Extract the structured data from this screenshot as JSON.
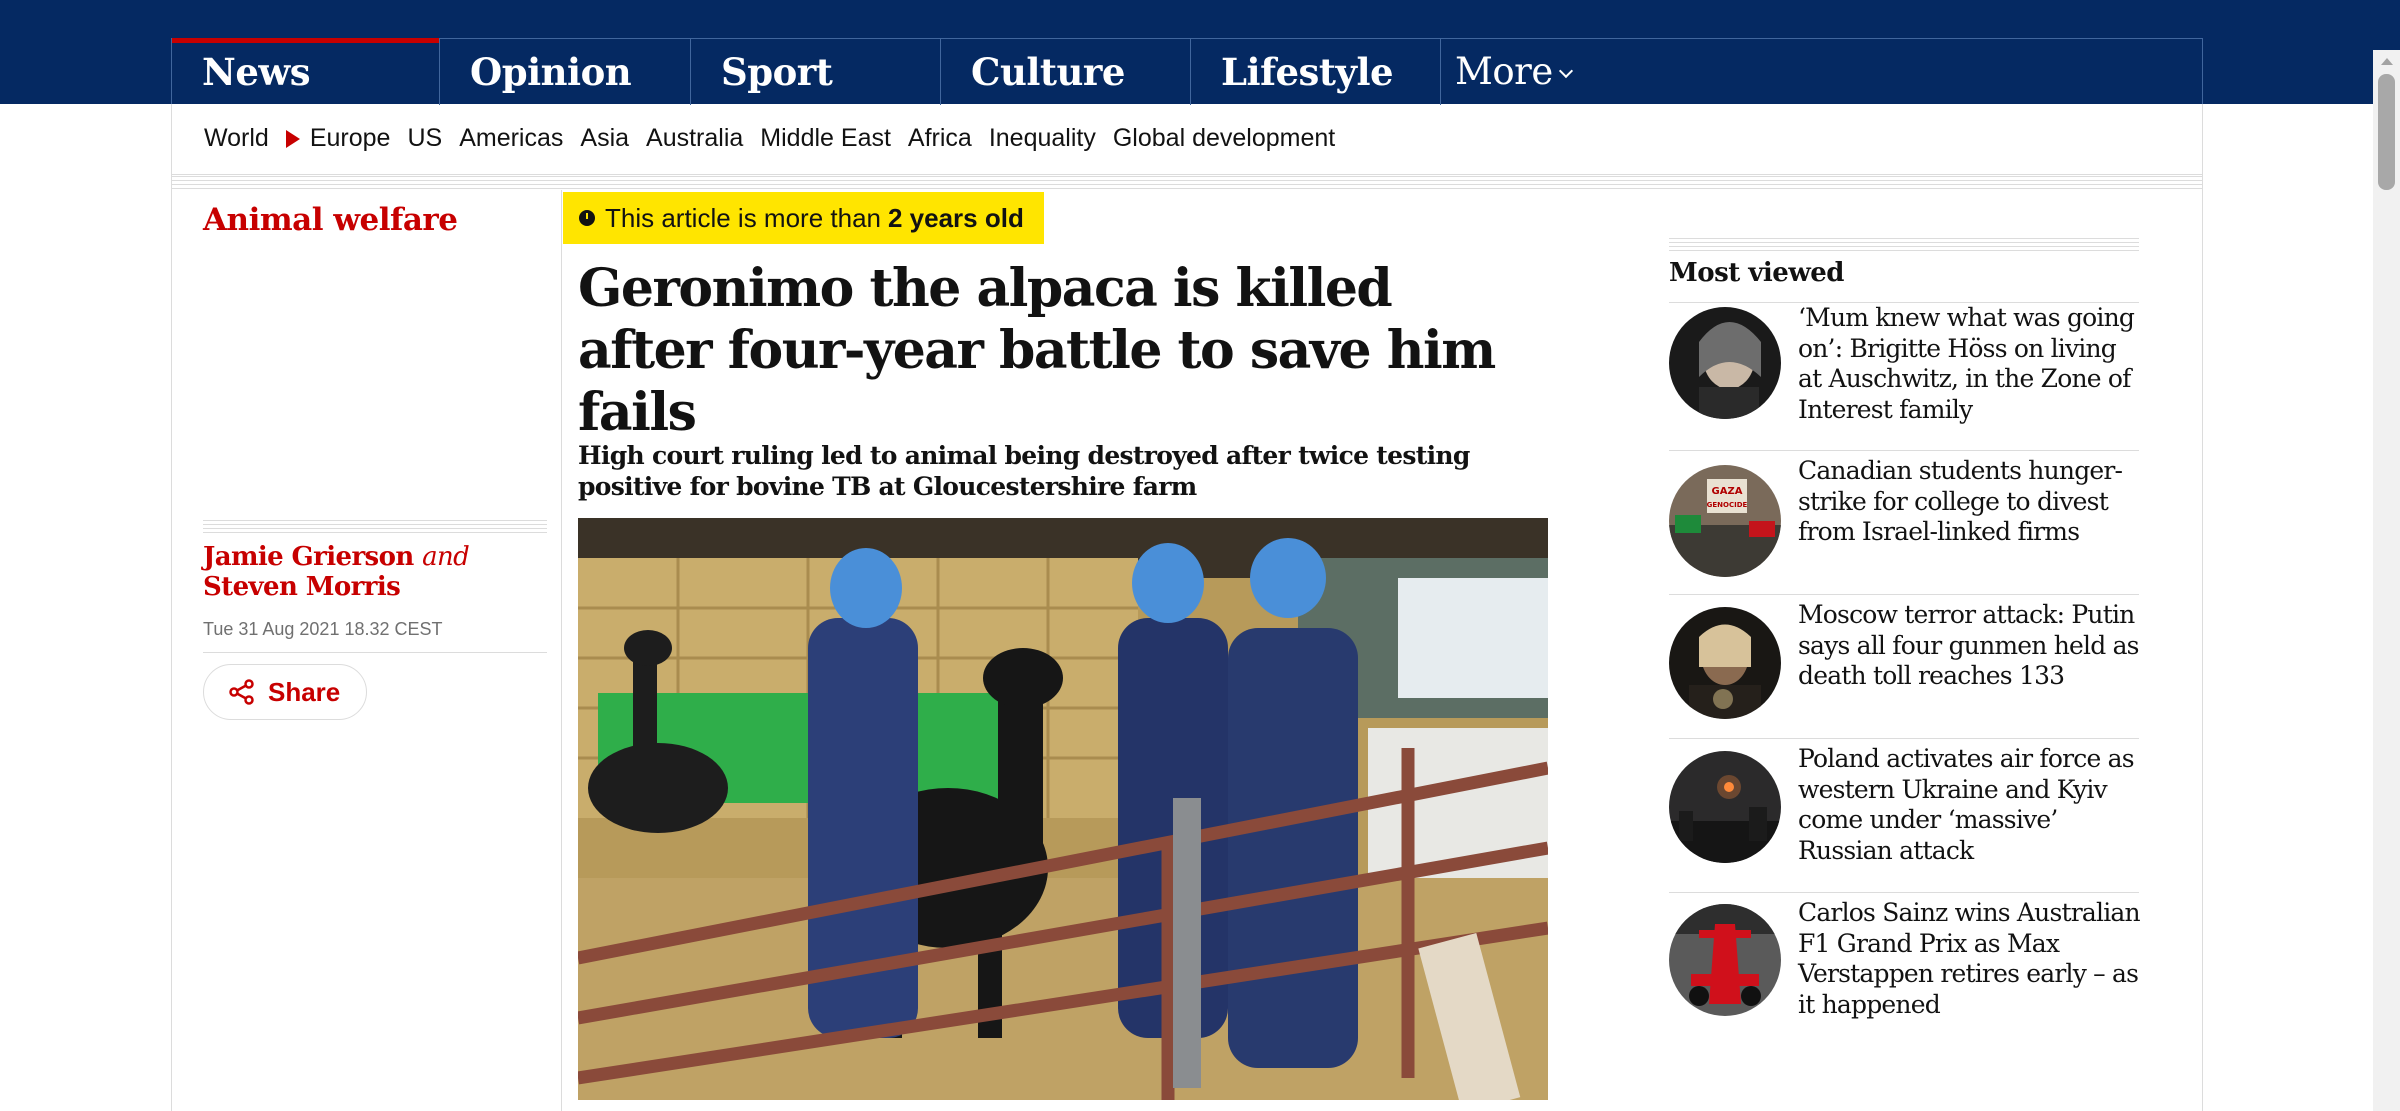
{
  "nav": {
    "pillars": [
      "News",
      "Opinion",
      "Sport",
      "Culture",
      "Lifestyle"
    ],
    "more_label": "More"
  },
  "subnav": {
    "items": [
      "World",
      "Europe",
      "US",
      "Americas",
      "Asia",
      "Australia",
      "Middle East",
      "Africa",
      "Inequality",
      "Global development"
    ]
  },
  "article": {
    "section": "Animal welfare",
    "age_prefix": "This article is more than",
    "age_value": "2 years old",
    "headline": "Geronimo the alpaca is killed after four-year battle to save him fails",
    "standfirst": "High court ruling led to animal being destroyed after twice testing positive for bovine TB at Gloucestershire farm",
    "author1": "Jamie Grierson",
    "byline_and": "and",
    "author2": "Steven Morris",
    "date": "Tue 31 Aug 2021 18.32 CEST",
    "share_label": "Share"
  },
  "most_viewed": {
    "title": "Most viewed",
    "items": [
      {
        "headline": "‘Mum knew what was going on’: Brigitte Höss on living at Auschwitz, in the Zone of Interest family"
      },
      {
        "headline": "Canadian students hunger-strike for college to divest from Israel-linked firms"
      },
      {
        "headline": "Moscow terror attack: Putin says all four gunmen held as death toll reaches 133"
      },
      {
        "headline": "Poland activates air force as western Ukraine and Kyiv come under ‘massive’ Russian attack"
      },
      {
        "headline": "Carlos Sainz wins Australian F1 Grand Prix as Max Verstappen retires early – as it happened"
      }
    ]
  },
  "thumb_signs": [
    "GAZA",
    "GENOCIDE"
  ],
  "colors": {
    "nav_background": "#052962",
    "accent_red": "#c70000",
    "badge_yellow": "#ffe500"
  }
}
